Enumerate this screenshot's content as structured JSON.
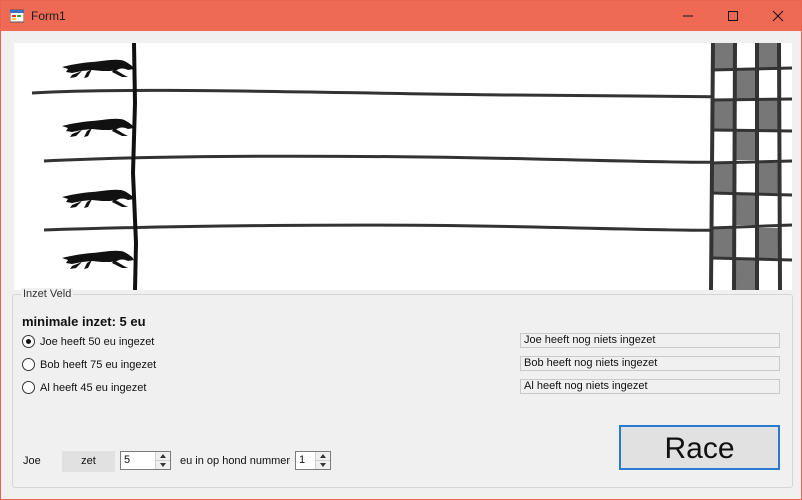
{
  "window": {
    "title": "Form1"
  },
  "icons": {
    "app": "winforms-app-icon",
    "minimize": "minimize-icon",
    "maximize": "maximize-icon",
    "close": "close-icon",
    "dog": "greyhound-icon"
  },
  "colors": {
    "titlebar": "#ef6a55",
    "accent_border": "#2a7bd0"
  },
  "inzet_veld": {
    "label": "Inzet Veld",
    "min_inzet": "minimale inzet: 5 eu",
    "bettors": [
      {
        "label": "Joe heeft 50 eu ingezet",
        "status": "Joe heeft nog niets ingezet",
        "selected": true
      },
      {
        "label": "Bob heeft 75 eu ingezet",
        "status": "Bob heeft nog niets ingezet",
        "selected": false
      },
      {
        "label": "Al heeft 45 eu ingezet",
        "status": "Al heeft nog niets ingezet",
        "selected": false
      }
    ],
    "bet": {
      "name": "Joe",
      "zet_label": "zet",
      "amount": "5",
      "middle_text": "eu in op hond nummer",
      "dog_number": "1"
    },
    "race_label": "Race"
  }
}
